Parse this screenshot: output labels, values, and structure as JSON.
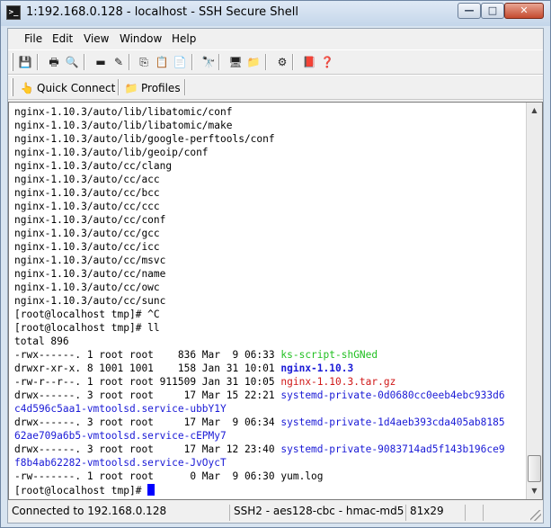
{
  "window": {
    "title": "1:192.168.0.128 - localhost - SSH Secure Shell",
    "controls": {
      "minimize": "—",
      "maximize": "□",
      "close": "✕"
    }
  },
  "menu": [
    "File",
    "Edit",
    "View",
    "Window",
    "Help"
  ],
  "toolbar": {
    "icons": [
      {
        "name": "save-icon",
        "glyph": "💾"
      },
      {
        "name": "print-icon",
        "glyph": "🖶"
      },
      {
        "name": "print-preview-icon",
        "glyph": "🔍"
      },
      {
        "name": "disconnect-icon",
        "glyph": "▬"
      },
      {
        "name": "new-connection-icon",
        "glyph": "✎"
      },
      {
        "name": "copy-icon",
        "glyph": "⎘"
      },
      {
        "name": "paste-icon",
        "glyph": "📋"
      },
      {
        "name": "paste-alt-icon",
        "glyph": "📄"
      },
      {
        "name": "find-icon",
        "glyph": "🔭"
      },
      {
        "name": "new-terminal-icon",
        "glyph": "🖥"
      },
      {
        "name": "file-transfer-icon",
        "glyph": "📁"
      },
      {
        "name": "settings-icon",
        "glyph": "⚙"
      },
      {
        "name": "profiles-book-icon",
        "glyph": "📕"
      },
      {
        "name": "help-icon",
        "glyph": "❓"
      }
    ]
  },
  "quickbar": {
    "quick_connect": "Quick Connect",
    "profiles": "Profiles"
  },
  "terminal": {
    "lines": [
      [
        {
          "t": "nginx-1.10.3/auto/lib/libatomic/conf"
        }
      ],
      [
        {
          "t": "nginx-1.10.3/auto/lib/libatomic/make"
        }
      ],
      [
        {
          "t": "nginx-1.10.3/auto/lib/google-perftools/conf"
        }
      ],
      [
        {
          "t": "nginx-1.10.3/auto/lib/geoip/conf"
        }
      ],
      [
        {
          "t": "nginx-1.10.3/auto/cc/clang"
        }
      ],
      [
        {
          "t": "nginx-1.10.3/auto/cc/acc"
        }
      ],
      [
        {
          "t": "nginx-1.10.3/auto/cc/bcc"
        }
      ],
      [
        {
          "t": "nginx-1.10.3/auto/cc/ccc"
        }
      ],
      [
        {
          "t": "nginx-1.10.3/auto/cc/conf"
        }
      ],
      [
        {
          "t": "nginx-1.10.3/auto/cc/gcc"
        }
      ],
      [
        {
          "t": "nginx-1.10.3/auto/cc/icc"
        }
      ],
      [
        {
          "t": "nginx-1.10.3/auto/cc/msvc"
        }
      ],
      [
        {
          "t": "nginx-1.10.3/auto/cc/name"
        }
      ],
      [
        {
          "t": "nginx-1.10.3/auto/cc/owc"
        }
      ],
      [
        {
          "t": "nginx-1.10.3/auto/cc/sunc"
        }
      ],
      [
        {
          "t": "[root@localhost tmp]# ^C"
        }
      ],
      [
        {
          "t": "[root@localhost tmp]# ll"
        }
      ],
      [
        {
          "t": "total 896"
        }
      ],
      [
        {
          "t": "-rwx------. 1 root root    836 Mar  9 06:33 "
        },
        {
          "t": "ks-script-shGNed",
          "c": "green"
        }
      ],
      [
        {
          "t": "drwxr-xr-x. 8 1001 1001    158 Jan 31 10:01 "
        },
        {
          "t": "nginx-1.10.3",
          "c": "bblue"
        }
      ],
      [
        {
          "t": "-rw-r--r--. 1 root root 911509 Jan 31 10:05 "
        },
        {
          "t": "nginx-1.10.3.tar.gz",
          "c": "red"
        }
      ],
      [
        {
          "t": "drwx------. 3 root root     17 Mar 15 22:21 "
        },
        {
          "t": "systemd-private-0d0680cc0eeb4ebc933d6",
          "c": "blue"
        }
      ],
      [
        {
          "t": "c4d596c5aa1-vmtoolsd.service-ubbY1Y",
          "c": "blue"
        }
      ],
      [
        {
          "t": "drwx------. 3 root root     17 Mar  9 06:34 "
        },
        {
          "t": "systemd-private-1d4aeb393cda405ab8185",
          "c": "blue"
        }
      ],
      [
        {
          "t": "62ae709a6b5-vmtoolsd.service-cEPMy7",
          "c": "blue"
        }
      ],
      [
        {
          "t": "drwx------. 3 root root     17 Mar 12 23:40 "
        },
        {
          "t": "systemd-private-9083714ad5f143b196ce9",
          "c": "blue"
        }
      ],
      [
        {
          "t": "f8b4ab62282-vmtoolsd.service-JvOycT",
          "c": "blue"
        }
      ],
      [
        {
          "t": "-rw-------. 1 root root      0 Mar  9 06:30 yum.log"
        }
      ],
      [
        {
          "t": "[root@localhost tmp]# "
        },
        {
          "cursor": true
        }
      ]
    ]
  },
  "status": {
    "connection": "Connected to 192.168.0.128",
    "cipher": "SSH2 - aes128-cbc - hmac-md5",
    "size": "81x29"
  }
}
